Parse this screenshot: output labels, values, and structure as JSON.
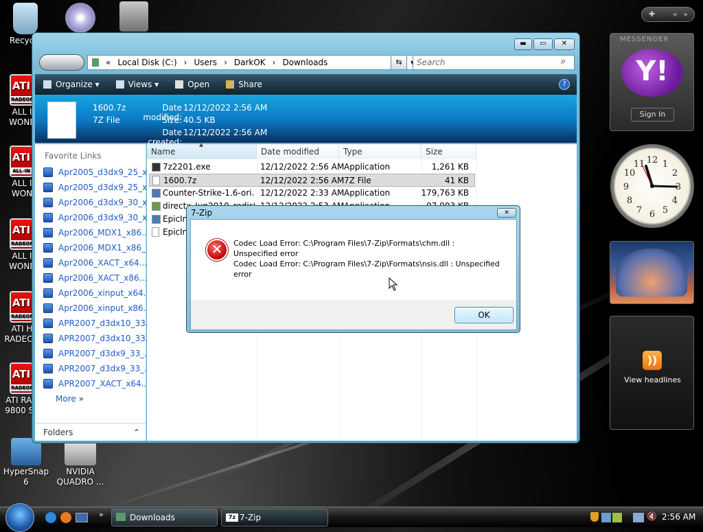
{
  "desktop": {
    "icons": [
      {
        "label": "Recycle"
      },
      {
        "label": "ALL I WONE"
      },
      {
        "label": "ALL I WON"
      },
      {
        "label": "ALL I WONE"
      },
      {
        "label": "ATI H RADEON"
      },
      {
        "label": "ATI RAD 9800 SE"
      },
      {
        "label": "HyperSnap 6"
      },
      {
        "label": "NVIDIA QUADRO ..."
      }
    ]
  },
  "sidebar": {
    "messenger_title": "MESSENGER",
    "sign_in": "Sign In",
    "headlines": "View headlines"
  },
  "explorer": {
    "breadcrumb": [
      "Local Disk (C:)",
      "Users",
      "DarkOK",
      "Downloads"
    ],
    "search_placeholder": "Search",
    "toolbar": {
      "organize": "Organize",
      "views": "Views",
      "open": "Open",
      "share": "Share"
    },
    "details": {
      "name": "1600.7z",
      "type": "7Z File",
      "modified_label": "Date modified:",
      "modified": "12/12/2022 2:56 AM",
      "size_label": "Size:",
      "size": "40.5 KB",
      "created_label": "Date created:",
      "created": "12/12/2022 2:56 AM"
    },
    "favorites_title": "Favorite Links",
    "favorites": [
      "Apr2005_d3dx9_25_x...",
      "Apr2005_d3dx9_25_x...",
      "Apr2006_d3dx9_30_x...",
      "Apr2006_d3dx9_30_x...",
      "Apr2006_MDX1_x86....",
      "Apr2006_MDX1_x86_...",
      "Apr2006_XACT_x64....",
      "Apr2006_XACT_x86....",
      "Apr2006_xinput_x64....",
      "Apr2006_xinput_x86....",
      "APR2007_d3dx10_33...",
      "APR2007_d3dx10_33...",
      "APR2007_d3dx9_33_...",
      "APR2007_d3dx9_33_...",
      "APR2007_XACT_x64...."
    ],
    "more": "More",
    "folders": "Folders",
    "columns": {
      "name": "Name",
      "date": "Date modified",
      "type": "Type",
      "size": "Size"
    },
    "files": [
      {
        "name": "7z2201.exe",
        "date": "12/12/2022 2:56 AM",
        "type": "Application",
        "size": "1,261 KB"
      },
      {
        "name": "1600.7z",
        "date": "12/12/2022 2:56 AM",
        "type": "7Z File",
        "size": "41 KB"
      },
      {
        "name": "Counter-Strike-1.6-ori...",
        "date": "12/12/2022 2:33 AM",
        "type": "Application",
        "size": "179,763 KB"
      },
      {
        "name": "directx_Jun2010_redist...",
        "date": "12/12/2022 2:53 AM",
        "type": "Application",
        "size": "97,003 KB"
      },
      {
        "name": "EpicIn",
        "date": "",
        "type": "",
        "size": ""
      },
      {
        "name": "EpicIn",
        "date": "",
        "type": "",
        "size": ""
      }
    ]
  },
  "dialog": {
    "title": "7-Zip",
    "line1": "Codec Load Error: C:\\Program Files\\7-Zip\\Formats\\chm.dll :",
    "line2": "Unspecified error",
    "line3": "Codec Load Error: C:\\Program Files\\7-Zip\\Formats\\nsis.dll : Unspecified",
    "line4": "error",
    "ok": "OK"
  },
  "taskbar": {
    "tasks": [
      {
        "label": "Downloads"
      },
      {
        "label": "7-Zip"
      }
    ],
    "clock": "2:56 AM"
  }
}
